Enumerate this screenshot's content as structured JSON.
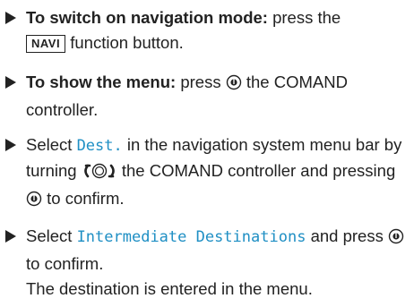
{
  "steps": [
    {
      "lead": "To switch on navigation mode:",
      "pre": "press the",
      "key": "NAVI",
      "post": "function button."
    },
    {
      "lead": "To show the menu:",
      "pre": "press",
      "icon": "press-controller-icon",
      "post": "the COMAND controller."
    },
    {
      "pre": "Select",
      "highlight": "Dest.",
      "mid1": "in the navigation system menu bar by turning",
      "icon1": "turn-controller-icon",
      "mid2": "the COMAND controller and pressing",
      "icon2": "press-controller-icon",
      "post": "to confirm."
    },
    {
      "pre": "Select",
      "highlight": "Intermediate Destinations",
      "mid": "and press",
      "icon": "press-controller-icon",
      "post": "to confirm.",
      "note": "The destination is entered in the menu."
    }
  ],
  "colors": {
    "text": "#222222",
    "highlight": "#1f8fc4"
  }
}
